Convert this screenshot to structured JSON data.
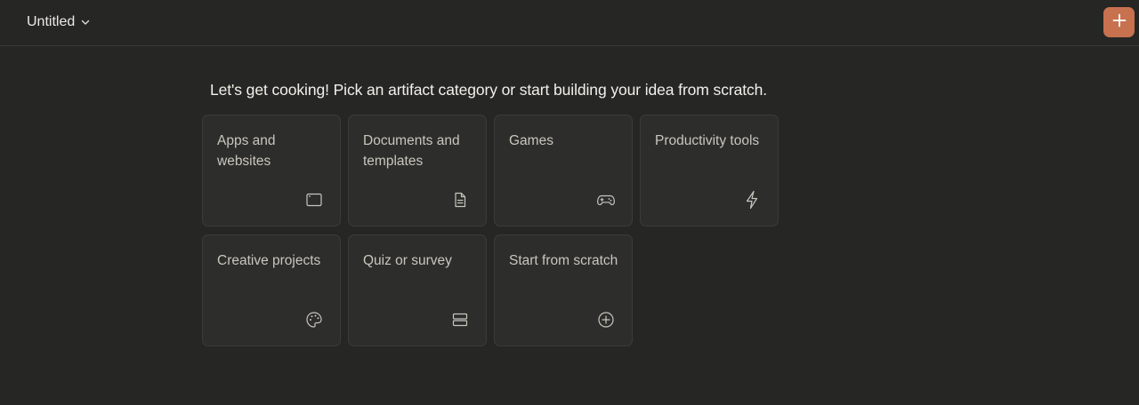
{
  "header": {
    "title": "Untitled",
    "title_icon": "chevron-down-icon",
    "new_button_icon": "plus-icon",
    "accent_color": "#c8714f"
  },
  "main": {
    "prompt": "Let's get cooking! Pick an artifact category or start building your idea from scratch.",
    "categories": [
      {
        "label": "Apps and websites",
        "icon": "browser-window-icon"
      },
      {
        "label": "Documents and templates",
        "icon": "document-icon"
      },
      {
        "label": "Games",
        "icon": "gamepad-icon"
      },
      {
        "label": "Productivity tools",
        "icon": "lightning-icon"
      },
      {
        "label": "Creative projects",
        "icon": "palette-icon"
      },
      {
        "label": "Quiz or survey",
        "icon": "list-rows-icon"
      },
      {
        "label": "Start from scratch",
        "icon": "plus-circle-icon"
      }
    ]
  }
}
